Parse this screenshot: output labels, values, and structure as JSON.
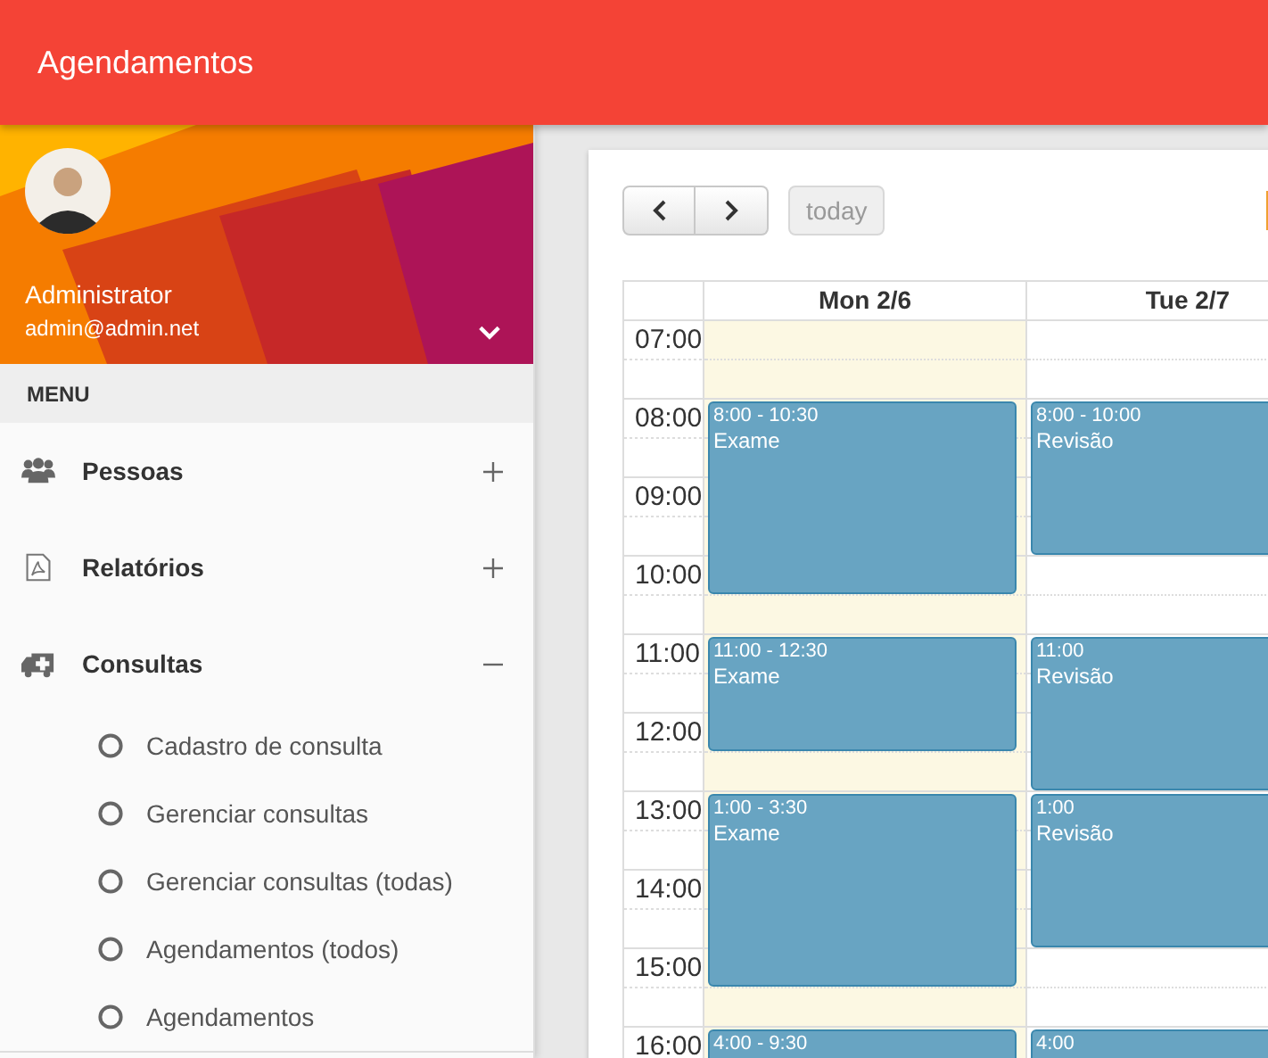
{
  "app_bar": {
    "title": "Agendamentos"
  },
  "sidebar": {
    "user": {
      "name": "Administrator",
      "email": "admin@admin.net"
    },
    "menu_heading": "MENU",
    "items": [
      {
        "label": "Pessoas",
        "kind": "people",
        "expanded": false
      },
      {
        "label": "Relatórios",
        "kind": "report",
        "expanded": false
      },
      {
        "label": "Consultas",
        "kind": "ambulance",
        "expanded": true,
        "children": [
          {
            "label": "Cadastro de consulta"
          },
          {
            "label": "Gerenciar consultas"
          },
          {
            "label": "Gerenciar consultas (todas)"
          },
          {
            "label": "Agendamentos (todos)"
          },
          {
            "label": "Agendamentos"
          }
        ]
      }
    ]
  },
  "calendar": {
    "today_button": {
      "label": "today",
      "disabled": true
    },
    "hours": [
      "07:00",
      "08:00",
      "09:00",
      "10:00",
      "11:00",
      "12:00",
      "13:00",
      "14:00",
      "15:00",
      "16:00"
    ],
    "days": [
      {
        "label": "Mon 2/6",
        "today": true,
        "events": [
          {
            "time": "8:00 - 10:30",
            "title": "Exame"
          },
          {
            "time": "11:00 - 12:30",
            "title": "Exame"
          },
          {
            "time": "1:00 - 3:30",
            "title": "Exame"
          },
          {
            "time": "4:00 - 9:30"
          }
        ]
      },
      {
        "label": "Tue 2/7",
        "today": false,
        "events": [
          {
            "time": "8:00 - 10:00",
            "title": "Revisão"
          },
          {
            "time": "11:00",
            "title": "Revisão"
          },
          {
            "time": "1:00",
            "title": "Revisão"
          },
          {
            "time": "4:00"
          }
        ]
      }
    ]
  }
}
